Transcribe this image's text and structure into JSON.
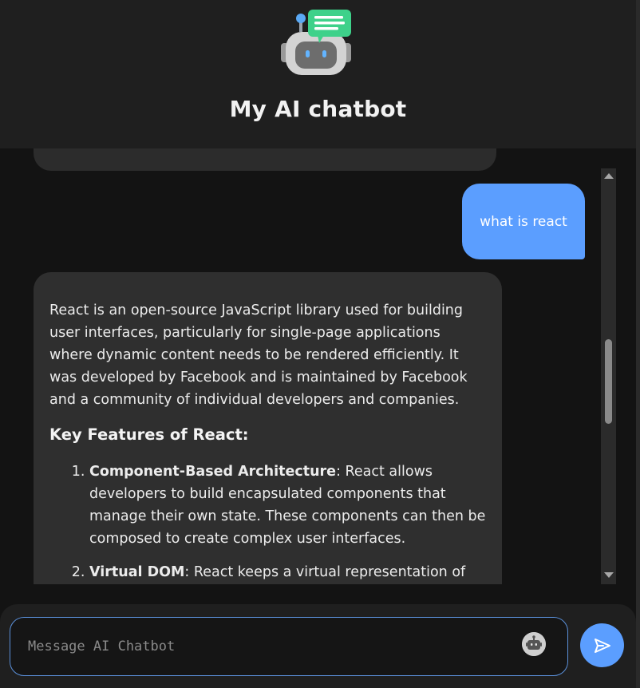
{
  "app": {
    "title": "My AI chatbot",
    "logo_icon": "robot-chat-icon",
    "accent_color": "#5b9eff"
  },
  "messages": [
    {
      "role": "user",
      "text": "what is react"
    },
    {
      "role": "bot",
      "intro": "React is an open-source JavaScript library used for building user interfaces, particularly for single-page applications where dynamic content needs to be rendered efficiently. It was developed by Facebook and is maintained by Facebook and a community of individual developers and companies.",
      "heading": "Key Features of React:",
      "features": [
        {
          "title": "Component-Based Architecture",
          "text": ": React allows developers to build encapsulated components that manage their own state. These components can then be composed to create complex user interfaces."
        },
        {
          "title": "Virtual DOM",
          "text": ": React keeps a virtual representation of the"
        }
      ]
    }
  ],
  "composer": {
    "placeholder": "Message AI Chatbot",
    "value": "",
    "bot_icon": "robot-icon",
    "send_icon": "send-icon"
  }
}
